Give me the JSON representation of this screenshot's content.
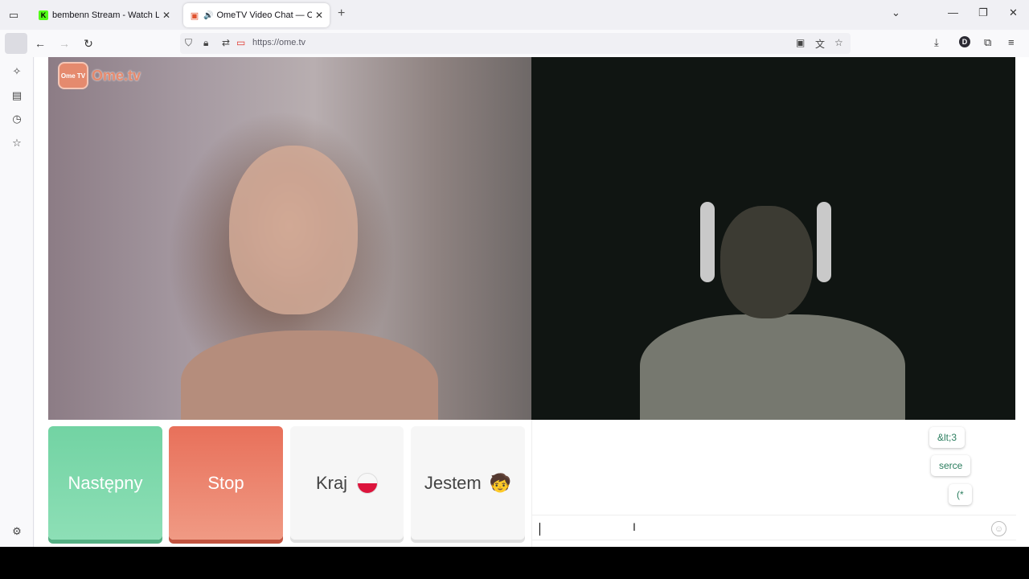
{
  "browser": {
    "tabs": [
      {
        "title": "bembenn Stream - Watch Live o",
        "favicon": "kick-icon"
      },
      {
        "title": "OmeTV Video Chat — Ome",
        "favicon": "ometv-icon",
        "playing_audio": true
      }
    ],
    "url": "https://ome.tv",
    "profile_initial": "D"
  },
  "page": {
    "logo_badge": "Ome TV",
    "logo_text": "Ome.tv",
    "buttons": {
      "next": "Następny",
      "stop": "Stop",
      "country": "Kraj",
      "gender": "Jestem"
    },
    "chat": {
      "suggestions": [
        "&lt;3",
        "serce",
        "(*"
      ],
      "input_value": ""
    }
  },
  "colors": {
    "next": "#72d3a3",
    "stop": "#e8705a",
    "suggestion_text": "#2a7d5e"
  }
}
